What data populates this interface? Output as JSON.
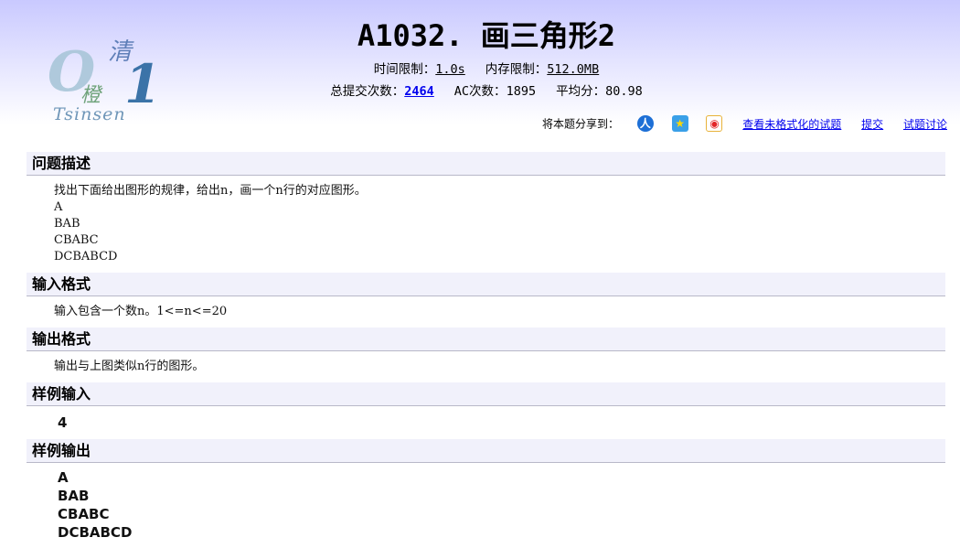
{
  "header": {
    "title": "A1032. 画三角形2",
    "logo": {
      "digits_zero": "O",
      "digits_one": "1",
      "char_top": "清",
      "char_bottom": "橙",
      "text": "Tsinsen"
    },
    "limits": {
      "time_label": "时间限制：",
      "time_value": "1.0s",
      "memory_label": "内存限制：",
      "memory_value": "512.0MB"
    },
    "stats": {
      "submissions_label": "总提交次数：",
      "submissions_value": "2464",
      "ac_label": "AC次数：",
      "ac_value": "1895",
      "avg_label": "平均分：",
      "avg_value": "80.98"
    }
  },
  "share": {
    "label": "将本题分享到：",
    "icons": [
      "renren-icon",
      "qzone-icon",
      "weibo-icon"
    ],
    "links": [
      "查看未格式化的试题",
      "提交",
      "试题讨论"
    ]
  },
  "sections": {
    "description": {
      "title": "问题描述",
      "lines": [
        "找出下面给出图形的规律，给出n，画一个n行的对应图形。",
        "A",
        "BAB",
        "CBABC",
        "DCBABCD"
      ]
    },
    "input_format": {
      "title": "输入格式",
      "text": "输入包含一个数n。1<=n<=20"
    },
    "output_format": {
      "title": "输出格式",
      "text": "输出与上图类似n行的图形。"
    },
    "sample_input": {
      "title": "样例输入",
      "lines": [
        "4"
      ]
    },
    "sample_output": {
      "title": "样例输出",
      "lines": [
        "A",
        "BAB",
        "CBABC",
        "DCBABCD"
      ]
    }
  },
  "colors": {
    "header_gradient_top": "#c9c9ff",
    "section_bg": "#f1f1fb",
    "link": "#0000ee"
  }
}
